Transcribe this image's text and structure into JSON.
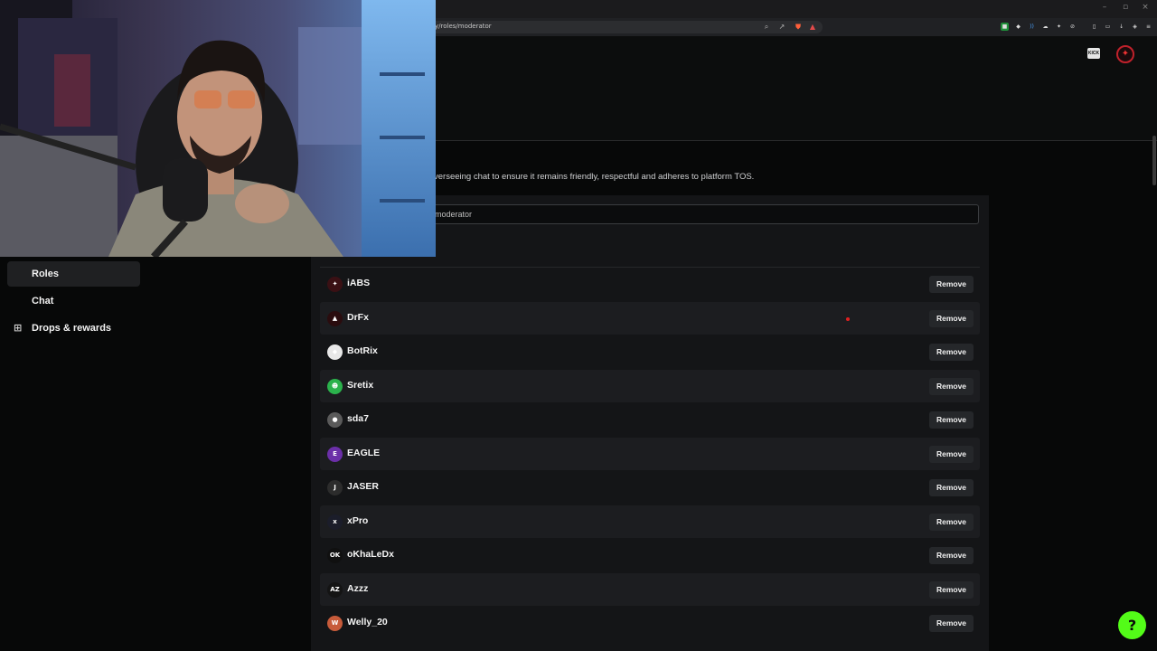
{
  "browser": {
    "url": "y/roles/moderator",
    "window_controls": [
      "–",
      "▫",
      "×"
    ]
  },
  "header": {
    "badge_label": "KICK",
    "profile_icon": "profile-avatar-icon"
  },
  "sidebar": {
    "items": [
      {
        "label": "Roles",
        "active": true
      },
      {
        "label": "Chat",
        "active": false
      },
      {
        "label": "Drops & rewards",
        "active": false,
        "icon": "gift-icon"
      }
    ]
  },
  "main": {
    "description": "verseeing chat to ensure it remains friendly, respectful and adheres to platform TOS.",
    "role_input_value": "moderator"
  },
  "moderators": [
    {
      "name": "iABS",
      "avatar_color": "#3a1014",
      "avatar_glyph": "✦"
    },
    {
      "name": "DrFx",
      "avatar_color": "#2a0c0e",
      "avatar_glyph": "▲"
    },
    {
      "name": "BotRix",
      "avatar_color": "#e8e8e8",
      "avatar_glyph": "◆"
    },
    {
      "name": "Sretix",
      "avatar_color": "#2bb24c",
      "avatar_glyph": "☻"
    },
    {
      "name": "sda7",
      "avatar_color": "#5a5a5a",
      "avatar_glyph": "●"
    },
    {
      "name": "EAGLE",
      "avatar_color": "#6b2fa8",
      "avatar_glyph": "E"
    },
    {
      "name": "JASER",
      "avatar_color": "#2c2c2c",
      "avatar_glyph": "J"
    },
    {
      "name": "xPro",
      "avatar_color": "#1b1d2a",
      "avatar_glyph": "x"
    },
    {
      "name": "oKhaLeDx",
      "avatar_color": "#101010",
      "avatar_glyph": "OK"
    },
    {
      "name": "Azzz",
      "avatar_color": "#141414",
      "avatar_glyph": "AZ"
    },
    {
      "name": "Welly_20",
      "avatar_color": "#c75b3a",
      "avatar_glyph": "W"
    }
  ],
  "remove_label": "Remove",
  "colors": {
    "accent": "#53fc18",
    "background": "#070808",
    "panel": "#141517"
  }
}
